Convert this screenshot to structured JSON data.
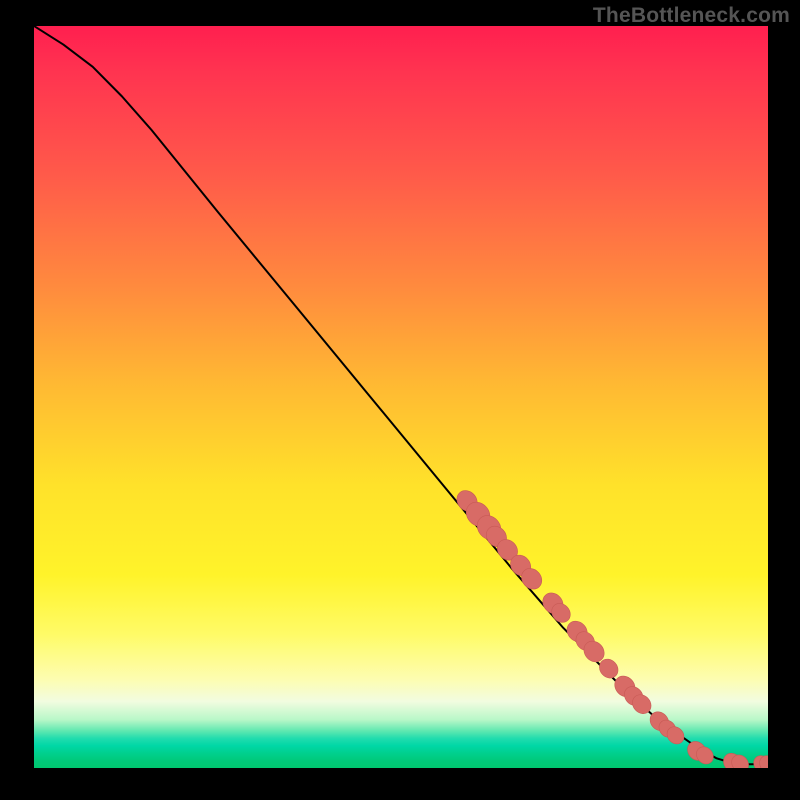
{
  "watermark": "TheBottleneck.com",
  "colors": {
    "point_fill": "#d86b66",
    "point_stroke": "#c85a55",
    "curve_stroke": "#000000",
    "frame_bg": "#000000"
  },
  "chart_data": {
    "type": "line",
    "title": "",
    "xlabel": "",
    "ylabel": "",
    "xlim": [
      0,
      100
    ],
    "ylim": [
      0,
      100
    ],
    "grid": false,
    "legend": false,
    "curve": [
      {
        "x": 0,
        "y": 100
      },
      {
        "x": 4,
        "y": 97.5
      },
      {
        "x": 8,
        "y": 94.5
      },
      {
        "x": 12,
        "y": 90.5
      },
      {
        "x": 16,
        "y": 86
      },
      {
        "x": 25,
        "y": 75
      },
      {
        "x": 35,
        "y": 63
      },
      {
        "x": 45,
        "y": 51
      },
      {
        "x": 55,
        "y": 39
      },
      {
        "x": 65,
        "y": 27
      },
      {
        "x": 72,
        "y": 19
      },
      {
        "x": 80,
        "y": 11
      },
      {
        "x": 85,
        "y": 6.5
      },
      {
        "x": 90,
        "y": 3
      },
      {
        "x": 93,
        "y": 1.3
      },
      {
        "x": 95,
        "y": 0.7
      },
      {
        "x": 97,
        "y": 0.5
      },
      {
        "x": 100,
        "y": 0.5
      }
    ],
    "points": [
      {
        "x": 59,
        "y": 36,
        "r": 1.2
      },
      {
        "x": 60.5,
        "y": 34.2,
        "r": 1.4
      },
      {
        "x": 62,
        "y": 32.4,
        "r": 1.4
      },
      {
        "x": 63,
        "y": 31.2,
        "r": 1.2
      },
      {
        "x": 64.5,
        "y": 29.4,
        "r": 1.2
      },
      {
        "x": 66.3,
        "y": 27.3,
        "r": 1.2
      },
      {
        "x": 67.8,
        "y": 25.5,
        "r": 1.2
      },
      {
        "x": 70.7,
        "y": 22.2,
        "r": 1.2
      },
      {
        "x": 71.8,
        "y": 20.9,
        "r": 1.1
      },
      {
        "x": 74,
        "y": 18.4,
        "r": 1.2
      },
      {
        "x": 75.1,
        "y": 17.1,
        "r": 1.1
      },
      {
        "x": 76.3,
        "y": 15.7,
        "r": 1.2
      },
      {
        "x": 78.3,
        "y": 13.4,
        "r": 1.1
      },
      {
        "x": 80.5,
        "y": 11,
        "r": 1.2
      },
      {
        "x": 81.7,
        "y": 9.7,
        "r": 1.1
      },
      {
        "x": 82.8,
        "y": 8.6,
        "r": 1.1
      },
      {
        "x": 85.2,
        "y": 6.3,
        "r": 1.1
      },
      {
        "x": 86.3,
        "y": 5.3,
        "r": 1.0
      },
      {
        "x": 87.4,
        "y": 4.4,
        "r": 1.0
      },
      {
        "x": 90.3,
        "y": 2.3,
        "r": 1.1
      },
      {
        "x": 91.4,
        "y": 1.7,
        "r": 1.0
      },
      {
        "x": 95.2,
        "y": 0.7,
        "r": 1.1
      },
      {
        "x": 96.2,
        "y": 0.6,
        "r": 1.0
      },
      {
        "x": 99.2,
        "y": 0.5,
        "r": 1.0
      },
      {
        "x": 100,
        "y": 0.5,
        "r": 1.0
      }
    ]
  }
}
